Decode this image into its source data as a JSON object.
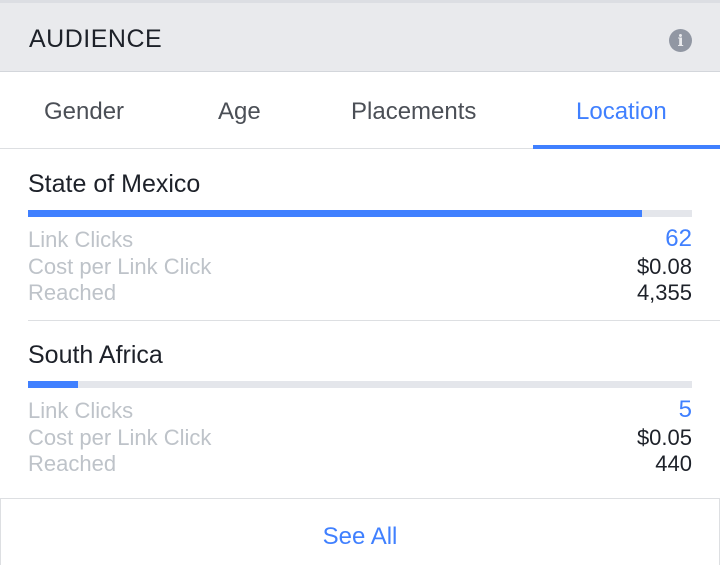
{
  "header": {
    "title": "AUDIENCE",
    "info_icon": "info-icon"
  },
  "tabs": [
    {
      "label": "Gender",
      "active": false
    },
    {
      "label": "Age",
      "active": false
    },
    {
      "label": "Placements",
      "active": false
    },
    {
      "label": "Location",
      "active": true
    }
  ],
  "locations": [
    {
      "name": "State of Mexico",
      "bar_fraction": 0.925,
      "metrics": [
        {
          "label": "Link Clicks",
          "value": "62"
        },
        {
          "label": "Cost per Link Click",
          "value": "$0.08"
        },
        {
          "label": "Reached",
          "value": "4,355"
        }
      ]
    },
    {
      "name": "South Africa",
      "bar_fraction": 0.075,
      "metrics": [
        {
          "label": "Link Clicks",
          "value": "5"
        },
        {
          "label": "Cost per Link Click",
          "value": "$0.05"
        },
        {
          "label": "Reached",
          "value": "440"
        }
      ]
    }
  ],
  "footer": {
    "see_all_label": "See All"
  },
  "colors": {
    "accent": "#4080ff",
    "header_bg": "#e9eaed",
    "label_gray": "#bec3c9",
    "text_dark": "#1d2129"
  }
}
